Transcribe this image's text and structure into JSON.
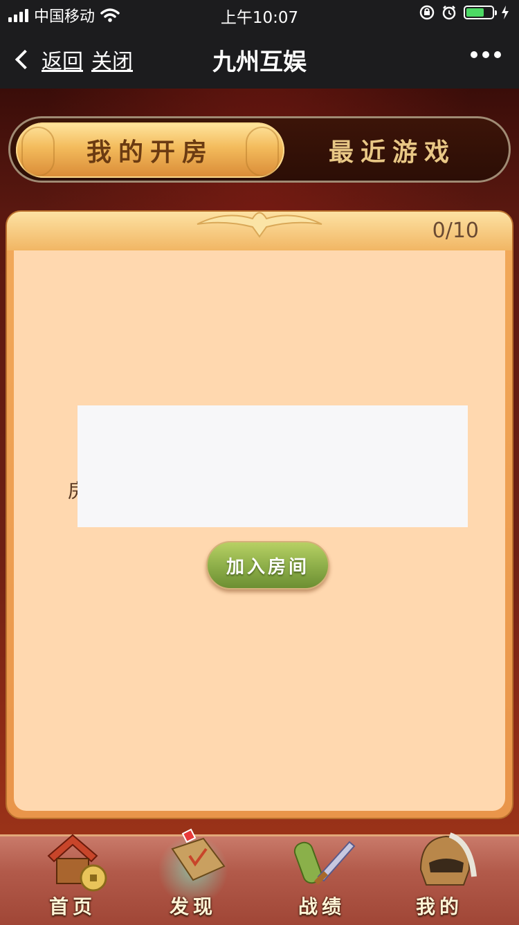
{
  "status_bar": {
    "carrier": "中国移动",
    "time": "上午10:07"
  },
  "nav": {
    "back_label": "返回",
    "close_label": "关闭",
    "title": "九州互娱"
  },
  "tabs": {
    "active": "我的开房",
    "inactive": "最近游戏"
  },
  "panel": {
    "count": "0/10",
    "room_label": "房",
    "join_button": "加入房间"
  },
  "bottom_nav": {
    "items": [
      {
        "label": "首页",
        "icon": "house-coin-icon"
      },
      {
        "label": "发现",
        "icon": "discover-scroll-icon"
      },
      {
        "label": "战绩",
        "icon": "scroll-sword-icon"
      },
      {
        "label": "我的",
        "icon": "warrior-helmet-icon"
      }
    ]
  },
  "colors": {
    "panel_bg": "#ffd8af",
    "tab_active": "#f3bb5c",
    "join_button": "#8fb04a",
    "battery": "#4cd964"
  }
}
